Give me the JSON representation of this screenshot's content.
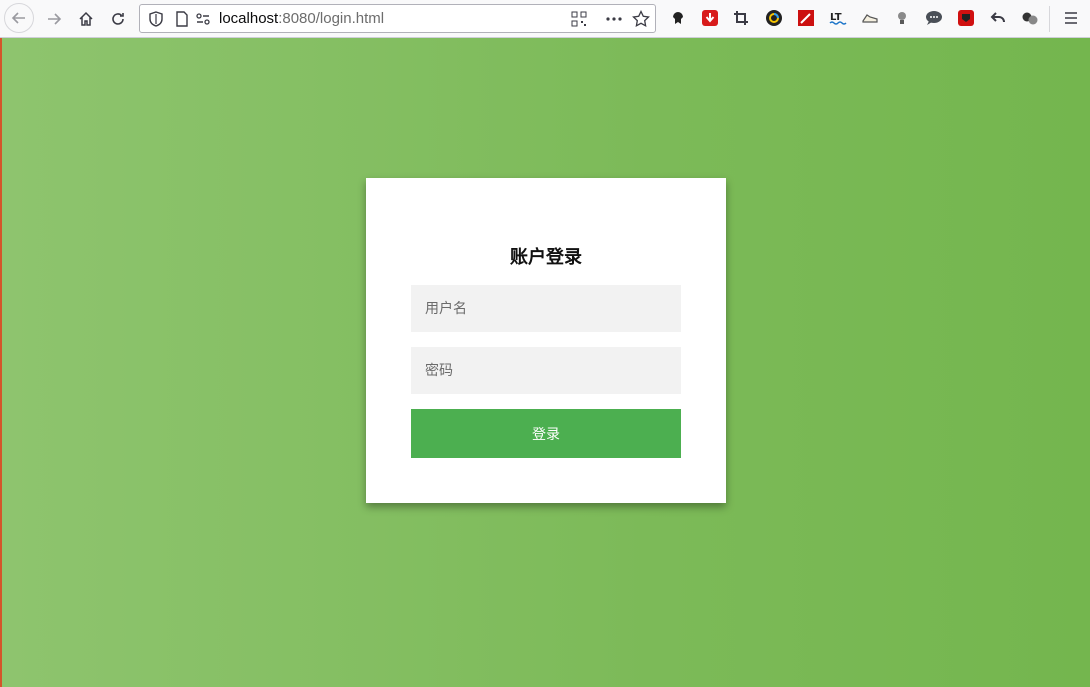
{
  "browser": {
    "url_host": "localhost",
    "url_rest": ":8080/login.html",
    "extensions": [
      {
        "icon": "ghost-icon",
        "color": "#222222"
      },
      {
        "icon": "download-icon",
        "color": "#d81b1b"
      },
      {
        "icon": "crop-icon",
        "color": "#3b3b45"
      },
      {
        "icon": "color-wheel-icon",
        "color": "#222222"
      },
      {
        "icon": "magic-wand-icon",
        "color": "#cc1010"
      },
      {
        "icon": "languagetool-icon",
        "color": "#1a73c8"
      },
      {
        "icon": "sneaker-icon",
        "color": "#555555"
      },
      {
        "icon": "lightbulb-icon",
        "color": "#5a5a5a"
      },
      {
        "icon": "chat-bubble-icon",
        "color": "#4a4f57"
      },
      {
        "icon": "red-save-icon",
        "color": "#d01010"
      },
      {
        "icon": "undo-arrow-icon",
        "color": "#3b3b45"
      },
      {
        "icon": "balls-icon",
        "color": "#333333"
      }
    ]
  },
  "login": {
    "title": "账户登录",
    "username_placeholder": "用户名",
    "password_placeholder": "密码",
    "submit_label": "登录"
  },
  "colors": {
    "accent": "#4caf50",
    "background_left": "#8ec46e",
    "background_right": "#74b64e"
  }
}
